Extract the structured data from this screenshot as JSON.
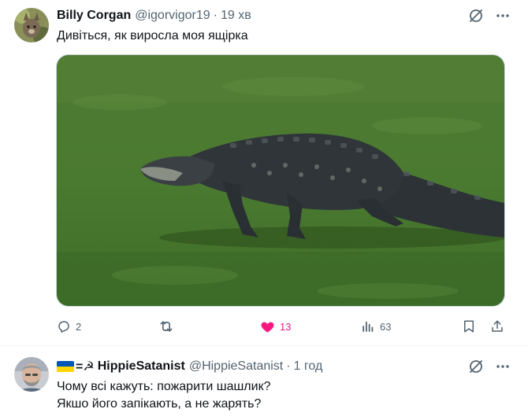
{
  "tweets": [
    {
      "author": {
        "name": "Billy Corgan",
        "handle": "@igorvigor19"
      },
      "time": "19 хв",
      "text": "Дивіться, як виросла моя ящірка",
      "media": {
        "description_icon": "alligator-photo"
      },
      "actions": {
        "replies": "2",
        "retweets": "",
        "likes": "13",
        "views": "63"
      },
      "liked": true
    },
    {
      "author": {
        "name": "HippieSatanist",
        "prefix_symbols": "=☭",
        "handle": "@HippieSatanist"
      },
      "time": "1 год",
      "text_lines": [
        "Чому всі кажуть: пожарити шашлик?",
        "Якшо його запікають, а не жарять?"
      ]
    }
  ],
  "colors": {
    "text_primary": "#0f1419",
    "text_secondary": "#536471",
    "like_active": "#f91880",
    "divider": "#eff3f4"
  },
  "icons": [
    "grok-icon",
    "more-icon",
    "reply-icon",
    "retweet-icon",
    "heart-icon",
    "views-icon",
    "bookmark-icon",
    "share-icon"
  ]
}
